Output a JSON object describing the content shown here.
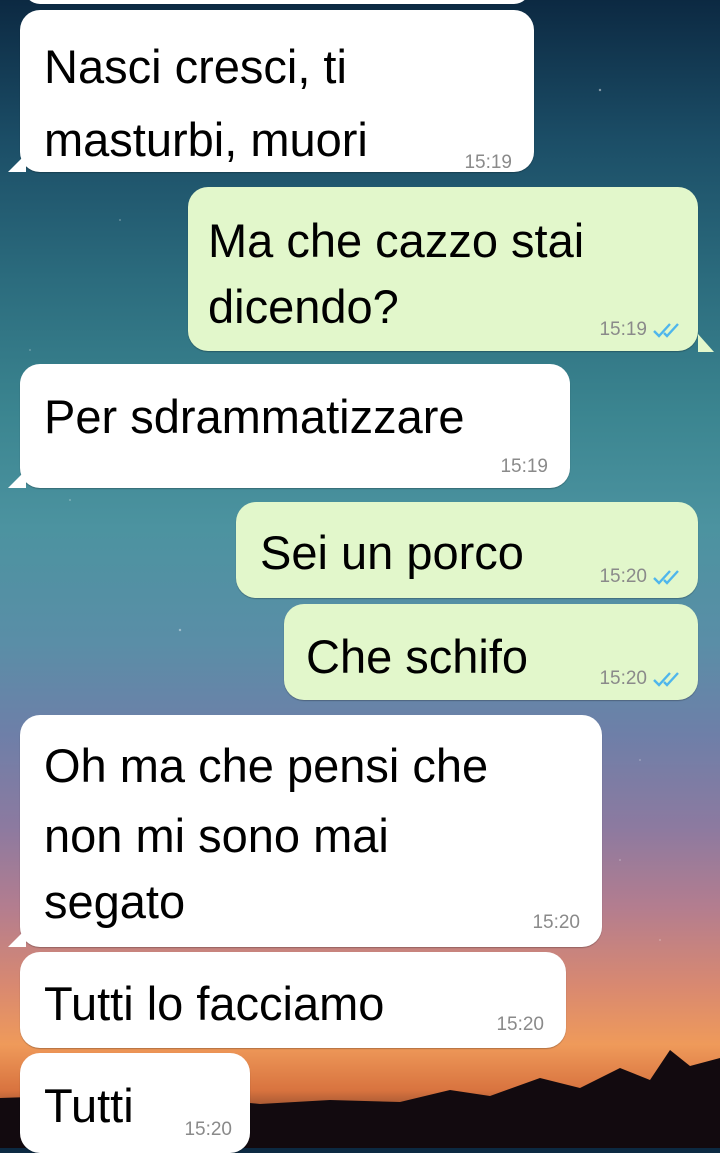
{
  "colors": {
    "incoming_bubble": "#ffffff",
    "outgoing_bubble": "#e2f7cb",
    "timestamp": "#8a8a8a",
    "read_check": "#4fb6ec"
  },
  "messages": [
    {
      "direction": "incoming",
      "lines": [
        "Nasci cresci, ti",
        "masturbi, muori"
      ],
      "time": "15:19"
    },
    {
      "direction": "outgoing",
      "lines": [
        "Ma che cazzo stai",
        "dicendo?"
      ],
      "time": "15:19",
      "status_icon": "double-check-icon"
    },
    {
      "direction": "incoming",
      "lines": [
        "Per sdrammatizzare"
      ],
      "time": "15:19"
    },
    {
      "direction": "outgoing",
      "lines": [
        "Sei un porco"
      ],
      "time": "15:20",
      "status_icon": "double-check-icon"
    },
    {
      "direction": "outgoing",
      "lines": [
        "Che schifo"
      ],
      "time": "15:20",
      "status_icon": "double-check-icon"
    },
    {
      "direction": "incoming",
      "lines": [
        "Oh ma che pensi che",
        "non mi sono mai",
        "segato"
      ],
      "time": "15:20"
    },
    {
      "direction": "incoming",
      "lines": [
        "Tutti lo facciamo"
      ],
      "time": "15:20"
    },
    {
      "direction": "incoming",
      "lines": [
        "Tutti"
      ],
      "time": "15:20"
    }
  ]
}
